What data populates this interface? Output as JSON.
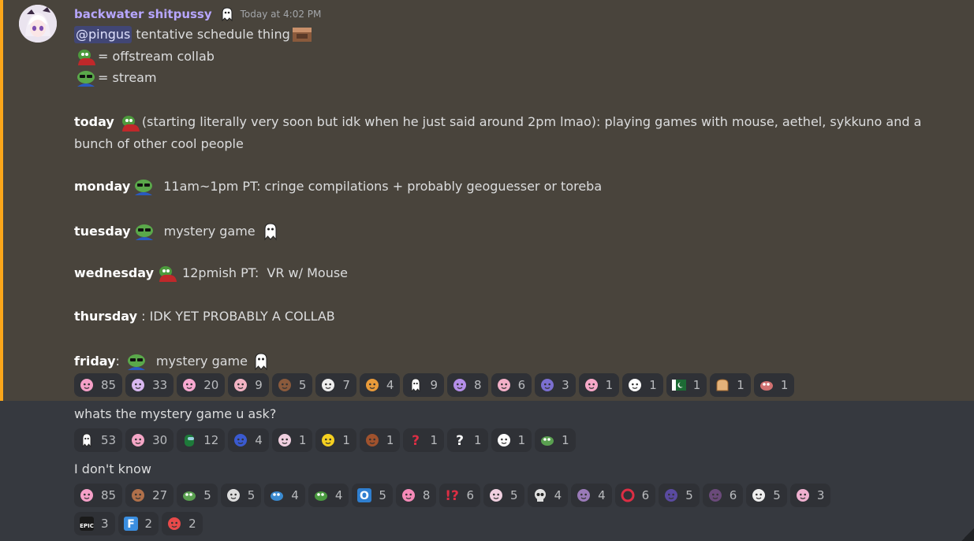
{
  "message1": {
    "username": "backwater shitpussy",
    "timestamp": "Today at 4:02 PM",
    "mention": "@pingus",
    "line1": "tentative schedule thing",
    "legend_offstream": "= offstream collab",
    "legend_stream": "= stream",
    "today_label": "today",
    "today_text": "(starting literally very soon but idk when he just said around 2pm lmao): playing games with mouse, aethel, sykkuno and a bunch of other cool people",
    "monday_label": "monday",
    "monday_text": "11am~1pm PT: cringe compilations + probably geoguesser or toreba",
    "tuesday_label": "tuesday",
    "tuesday_text": "mystery game",
    "wednesday_label": "wednesday",
    "wednesday_text": "12pmish PT:  VR w/ Mouse",
    "thursday_label": "thursday",
    "thursday_text": " : IDK YET PROBABLY A COLLAB",
    "friday_label": "friday",
    "friday_colon": ":",
    "friday_text": "mystery game",
    "reactions": [
      {
        "icon": "pink-pig-emoji",
        "count": "85",
        "color": "#f5a0c8"
      },
      {
        "icon": "anime-girl-emoji",
        "count": "33",
        "color": "#d8b8f0"
      },
      {
        "icon": "pink-bunny-emoji",
        "count": "20",
        "color": "#f7a8d0"
      },
      {
        "icon": "pig-face-emoji",
        "count": "9",
        "color": "#f2b3c4"
      },
      {
        "icon": "face-photo-emoji",
        "count": "5",
        "color": "#8a5a3c"
      },
      {
        "icon": "troll-face-emoji",
        "count": "7",
        "color": "#eeeeee"
      },
      {
        "icon": "fire-crowd-emoji",
        "count": "4",
        "color": "#e89a3a"
      },
      {
        "icon": "ghost-emoji",
        "count": "9",
        "color": "#ffffff"
      },
      {
        "icon": "purple-girl-emoji",
        "count": "8",
        "color": "#b48ee8"
      },
      {
        "icon": "sunglasses-girl-emoji",
        "count": "6",
        "color": "#f3b0c8"
      },
      {
        "icon": "purple-hair-emoji",
        "count": "3",
        "color": "#7b6fd0"
      },
      {
        "icon": "pink-pig-face-emoji",
        "count": "1",
        "color": "#f7a8c8"
      },
      {
        "icon": "white-cat-emoji",
        "count": "1",
        "color": "#ffffff"
      },
      {
        "icon": "pakistan-flag-emoji",
        "count": "1",
        "color": "#1d6b35"
      },
      {
        "icon": "bread-emoji",
        "count": "1",
        "color": "#e3b27a"
      },
      {
        "icon": "pepe-face-emoji",
        "count": "1",
        "color": "#d07070"
      }
    ]
  },
  "message2": {
    "text": "whats the mystery game u ask?",
    "reactions": [
      {
        "icon": "ghost-emoji",
        "count": "53",
        "color": "#ffffff"
      },
      {
        "icon": "pink-cat-emoji",
        "count": "30",
        "color": "#f4a6c6"
      },
      {
        "icon": "among-us-emoji",
        "count": "12",
        "color": "#1e7a3a"
      },
      {
        "icon": "blue-hair-emoji",
        "count": "4",
        "color": "#3a5ad0"
      },
      {
        "icon": "dancing-cat-emoji",
        "count": "1",
        "color": "#f0d0e0"
      },
      {
        "icon": "pikachu-emoji",
        "count": "1",
        "color": "#f5d020"
      },
      {
        "icon": "face-photo-emoji",
        "count": "1",
        "color": "#a0522d"
      },
      {
        "icon": "red-question-emoji",
        "count": "1",
        "color": "#dd2e44"
      },
      {
        "icon": "white-question-emoji",
        "count": "1",
        "color": "#ffffff"
      },
      {
        "icon": "white-cat-emoji",
        "count": "1",
        "color": "#ffffff"
      },
      {
        "icon": "pepe-lying-emoji",
        "count": "1",
        "color": "#5aa050"
      }
    ]
  },
  "message3": {
    "text": "I don't know",
    "reactions": [
      {
        "icon": "pink-pig-emoji",
        "count": "85",
        "color": "#f5a0c8"
      },
      {
        "icon": "man-face-emoji",
        "count": "27",
        "color": "#b0704a"
      },
      {
        "icon": "pepe-lying-emoji",
        "count": "5",
        "color": "#5aa050"
      },
      {
        "icon": "scream-face-emoji",
        "count": "5",
        "color": "#dddddd"
      },
      {
        "icon": "pepe-blanket-emoji",
        "count": "4",
        "color": "#3a8ad0"
      },
      {
        "icon": "pepe-hat-emoji",
        "count": "4",
        "color": "#4a9a40"
      },
      {
        "icon": "o-button-emoji",
        "count": "5",
        "color": "#2f7fd0"
      },
      {
        "icon": "pink-pig-emoji",
        "count": "8",
        "color": "#f58ab8"
      },
      {
        "icon": "exclamation-question-emoji",
        "count": "6",
        "color": "#dd2e44"
      },
      {
        "icon": "dancing-cat-emoji",
        "count": "5",
        "color": "#f0d0e0"
      },
      {
        "icon": "skull-emoji",
        "count": "4",
        "color": "#e0e0e0"
      },
      {
        "icon": "purple-creature-emoji",
        "count": "4",
        "color": "#9a7ab8"
      },
      {
        "icon": "red-circle-emoji",
        "count": "6",
        "color": "#dd2e44"
      },
      {
        "icon": "dark-hair-girl-emoji",
        "count": "5",
        "color": "#5a4aa0"
      },
      {
        "icon": "dark-figure-emoji",
        "count": "6",
        "color": "#6a4a7a"
      },
      {
        "icon": "troll-face-emoji",
        "count": "5",
        "color": "#eeeeee"
      },
      {
        "icon": "pink-girl-emoji",
        "count": "3",
        "color": "#f0b0d0"
      },
      {
        "icon": "epic-games-emoji",
        "count": "3",
        "color": "#1a1a1a"
      },
      {
        "icon": "f-letter-emoji",
        "count": "2",
        "color": "#3a8ee0"
      },
      {
        "icon": "clown-emoji",
        "count": "2",
        "color": "#e84a4a"
      }
    ]
  },
  "emoji_names": {
    "header_badge": "ghost-badge-icon",
    "inline_face": "face-photo-icon",
    "red_pepe": "red-pepe-emoji",
    "green_pepe": "pepe-sunglasses-emoji",
    "ghost": "ghost-emoji"
  },
  "colors": {
    "highlight_bg": "#49443c",
    "highlight_bar": "#faa61a",
    "username": "#b7a6ff",
    "mention_bg": "#414675"
  }
}
